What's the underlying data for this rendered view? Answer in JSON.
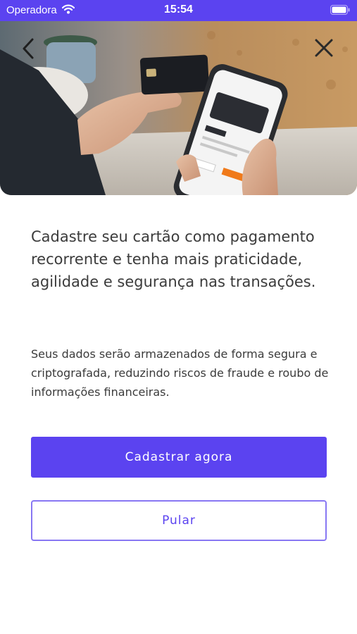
{
  "status_bar": {
    "carrier": "Operadora",
    "time": "15:54",
    "wifi_icon": "wifi-icon",
    "battery_icon": "battery-icon"
  },
  "hero": {
    "image": "hand-holding-card-and-phone-photo",
    "back_icon": "chevron-left-icon",
    "close_icon": "close-icon"
  },
  "content": {
    "headline": "Cadastre seu cartão como pagamento recorrente e tenha mais praticidade, agilidade e segurança nas transações.",
    "description": "Seus dados serão armazenados de forma segura e criptografada, reduzindo riscos de fraude e roubo de informações financeiras."
  },
  "actions": {
    "primary_label": "Cadastrar agora",
    "secondary_label": "Pular"
  },
  "colors": {
    "brand": "#5b43f0",
    "outline": "#8877f3",
    "text": "#3b3b3b"
  }
}
